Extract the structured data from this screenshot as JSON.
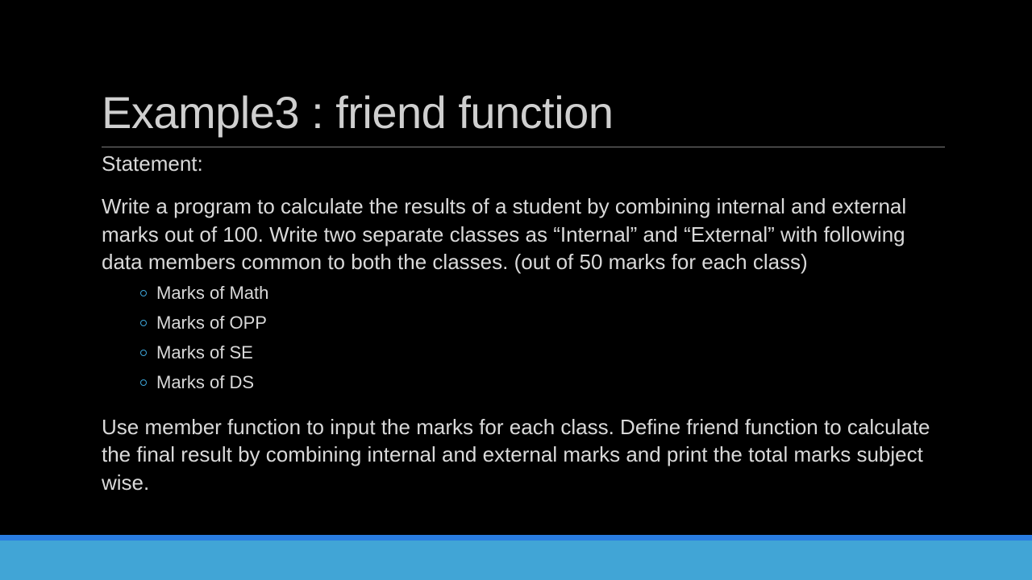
{
  "slide": {
    "title": "Example3 : friend function",
    "statement_label": "Statement:",
    "paragraph1": "Write a program to calculate the results of a student by combining internal and external marks out of 100. Write two separate classes as “Internal” and “External” with following data members common to both the classes. (out of 50 marks for each class)",
    "sub_items": [
      "Marks of Math",
      "Marks of OPP",
      "Marks of SE",
      "Marks of DS"
    ],
    "paragraph2": "Use member function to input the marks for each class. Define friend function to calculate the final result by combining internal and external marks and print the total marks subject wise."
  },
  "colors": {
    "background": "#000000",
    "text": "#d9d9d9",
    "bullet": "#3da5d9",
    "footer_line": "#2a7de1",
    "footer_bar": "#41a5d6"
  },
  "icons": {
    "bullet": "hollow-circle-bullet-icon"
  }
}
